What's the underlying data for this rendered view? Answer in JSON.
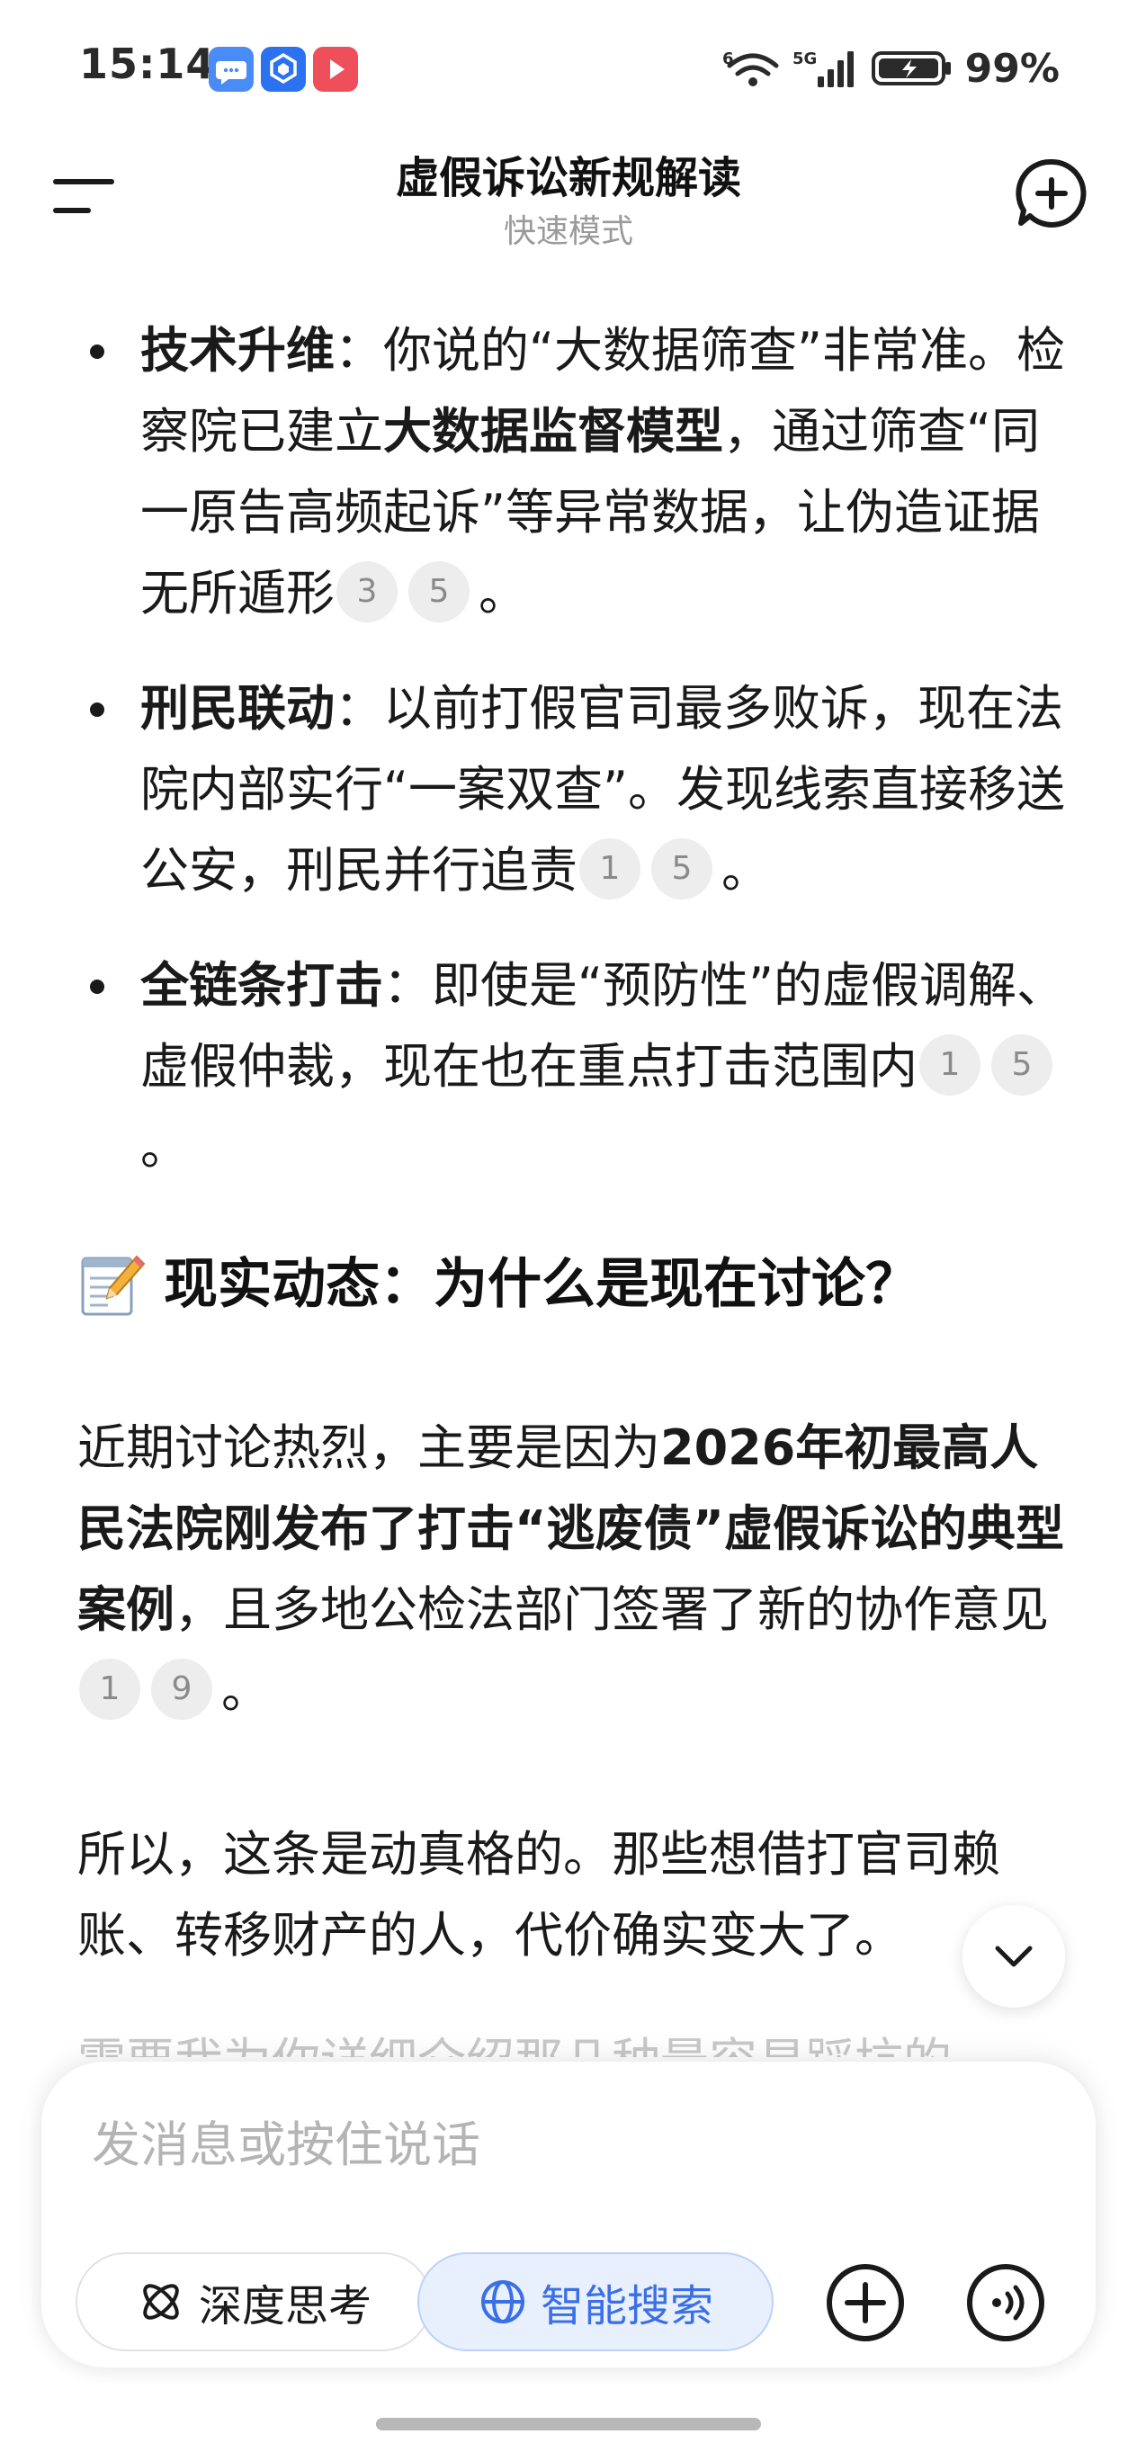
{
  "status_bar": {
    "time": "15:14",
    "wifi_label": "6",
    "network_label": "5G",
    "battery_text": "99%"
  },
  "header": {
    "title": "虚假诉讼新规解读",
    "subtitle": "快速模式"
  },
  "content": {
    "bullets": [
      {
        "term": "技术升维",
        "text_1": "：你说的“大数据筛查”非常准。检察院已建立",
        "bold_1": "大数据监督模型",
        "text_2": "，通过筛查“同一原告高频起诉”等异常数据，让伪造证据无所遁形",
        "cites": [
          "3",
          "5"
        ],
        "end": "。"
      },
      {
        "term": "刑民联动",
        "text_1": "：以前打假官司最多败诉，现在法院内部实行“一案双查”。发现线索直接移送公安，刑民并行追责",
        "cites": [
          "1",
          "5"
        ],
        "end": "。"
      },
      {
        "term": "全链条打击",
        "text_1": "：即使是“预防性”的虚假调解、虚假仲裁，现在也在重点打击范围内",
        "cites": [
          "1",
          "5"
        ],
        "end": "。"
      }
    ],
    "section_heading": "现实动态：为什么是现在讨论？",
    "para_1": {
      "text_1": "近期讨论热烈，主要是因为",
      "bold": "2026年初最高人民法院刚发布了打击“逃废债”虚假诉讼的典型案例",
      "text_2": "，且多地公检法部门签署了新的协作意见",
      "cites": [
        "1",
        "9"
      ],
      "end": "。"
    },
    "para_2": "所以，这条是动真格的。那些想借打官司赖账、转移财产的人，代价确实变大了。",
    "faded_line": "需要我为你详细介绍那几种最容易踩坑的"
  },
  "input": {
    "placeholder": "发消息或按住说话",
    "deep_think_label": "深度思考",
    "smart_search_label": "智能搜索"
  },
  "colors": {
    "accent": "#3b6fe6",
    "search_bg": "#e8effd",
    "cite_bg": "#ededed",
    "placeholder": "#b4b4b4"
  }
}
